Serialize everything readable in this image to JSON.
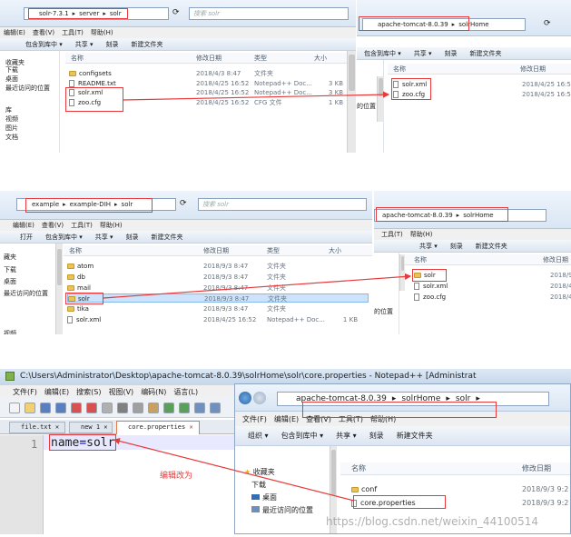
{
  "panel1": {
    "left": {
      "breadcrumb": [
        "solr-7.3.1",
        "server",
        "solr"
      ],
      "search_placeholder": "搜索 solr",
      "menu": [
        "编辑(E)",
        "查看(V)",
        "工具(T)",
        "帮助(H)"
      ],
      "toolbar": [
        "包含到库中 ▾",
        "共享 ▾",
        "刻录",
        "新建文件夹"
      ],
      "columns": [
        "名称",
        "修改日期",
        "类型",
        "大小"
      ],
      "nav": [
        "收藏夹",
        "下载",
        "桌面",
        "最近访问的位置",
        "库",
        "视频",
        "图片",
        "文档"
      ],
      "files": [
        {
          "name": "configsets",
          "date": "2018/4/3 8:47",
          "type": "文件夹",
          "size": "",
          "kind": "folder"
        },
        {
          "name": "README.txt",
          "date": "2018/4/25 16:52",
          "type": "Notepad++ Doc...",
          "size": "3 KB",
          "kind": "file"
        },
        {
          "name": "solr.xml",
          "date": "2018/4/25 16:52",
          "type": "Notepad++ Doc...",
          "size": "3 KB",
          "kind": "file"
        },
        {
          "name": "zoo.cfg",
          "date": "2018/4/25 16:52",
          "type": "CFG 文件",
          "size": "1 KB",
          "kind": "file"
        }
      ]
    },
    "right": {
      "breadcrumb": [
        "apache-tomcat-8.0.39",
        "solrHome"
      ],
      "toolbar": [
        "包含到库中 ▾",
        "共享 ▾",
        "刻录",
        "新建文件夹"
      ],
      "columns": [
        "名称",
        "修改日期"
      ],
      "nav": [
        "的位置"
      ],
      "files": [
        {
          "name": "solr.xml",
          "date": "2018/4/25 16:52",
          "kind": "file"
        },
        {
          "name": "zoo.cfg",
          "date": "2018/4/25 16:52",
          "kind": "file"
        }
      ]
    }
  },
  "panel2": {
    "left": {
      "breadcrumb": [
        "example",
        "example-DIH",
        "solr"
      ],
      "search_placeholder": "搜索 solr",
      "menu": [
        "编辑(E)",
        "查看(V)",
        "工具(T)",
        "帮助(H)"
      ],
      "toolbar": [
        "打开",
        "包含到库中 ▾",
        "共享 ▾",
        "刻录",
        "新建文件夹"
      ],
      "columns": [
        "名称",
        "修改日期",
        "类型",
        "大小"
      ],
      "nav": [
        "藏夹",
        "下载",
        "桌面",
        "最近访问的位置",
        "",
        "",
        "",
        "视频"
      ],
      "files": [
        {
          "name": "atom",
          "date": "2018/9/3 8:47",
          "type": "文件夹",
          "size": "",
          "kind": "folder"
        },
        {
          "name": "db",
          "date": "2018/9/3 8:47",
          "type": "文件夹",
          "size": "",
          "kind": "folder"
        },
        {
          "name": "mail",
          "date": "2018/9/3 8:47",
          "type": "文件夹",
          "size": "",
          "kind": "folder"
        },
        {
          "name": "solr",
          "date": "2018/9/3 8:47",
          "type": "文件夹",
          "size": "",
          "kind": "folder"
        },
        {
          "name": "tika",
          "date": "2018/9/3 8:47",
          "type": "文件夹",
          "size": "",
          "kind": "folder"
        },
        {
          "name": "solr.xml",
          "date": "2018/4/25 16:52",
          "type": "Notepad++ Doc...",
          "size": "1 KB",
          "kind": "file"
        }
      ]
    },
    "right": {
      "breadcrumb": [
        "apache-tomcat-8.0.39",
        "solrHome"
      ],
      "menu": [
        "工具(T)",
        "帮助(H)"
      ],
      "toolbar": [
        "共享 ▾",
        "刻录",
        "新建文件夹"
      ],
      "columns": [
        "名称",
        "修改日期"
      ],
      "nav": [
        "的位置"
      ],
      "files": [
        {
          "name": "solr",
          "date": "2018/9",
          "kind": "folder"
        },
        {
          "name": "solr.xml",
          "date": "2018/4",
          "kind": "file"
        },
        {
          "name": "zoo.cfg",
          "date": "2018/4",
          "kind": "file"
        }
      ]
    }
  },
  "panel3": {
    "notepad": {
      "title": "C:\\Users\\Administrator\\Desktop\\apache-tomcat-8.0.39\\solrHome\\solr\\core.properties - Notepad++ [Administrat",
      "menu": [
        "文件(F)",
        "编辑(E)",
        "搜索(S)",
        "视图(V)",
        "编码(N)",
        "语言(L)"
      ],
      "tabs": [
        "file.txt",
        "new 1",
        "core.properties"
      ],
      "line_number": "1",
      "code_key": "name",
      "code_eq": "=",
      "code_value": "solr",
      "annotation": "编辑改为"
    },
    "explorer": {
      "breadcrumb": [
        "apache-tomcat-8.0.39",
        "solrHome",
        "solr"
      ],
      "menu": [
        "文件(F)",
        "编辑(E)",
        "查看(V)",
        "工具(T)",
        "帮助(H)"
      ],
      "toolbar": [
        "组织 ▾",
        "包含到库中 ▾",
        "共享 ▾",
        "刻录",
        "新建文件夹"
      ],
      "columns": [
        "名称",
        "修改日期"
      ],
      "nav": [
        "收藏夹",
        "下载",
        "桌面",
        "最近访问的位置"
      ],
      "files": [
        {
          "name": "conf",
          "date": "2018/9/3 9:2",
          "kind": "folder"
        },
        {
          "name": "core.properties",
          "date": "2018/9/3 9:2",
          "kind": "file"
        }
      ]
    },
    "watermark": "https://blog.csdn.net/weixin_44100514"
  },
  "colors": {
    "annotation_red": "#e83a3a",
    "folder_yellow": "#e9c25a",
    "selection": "#cce3fb"
  }
}
